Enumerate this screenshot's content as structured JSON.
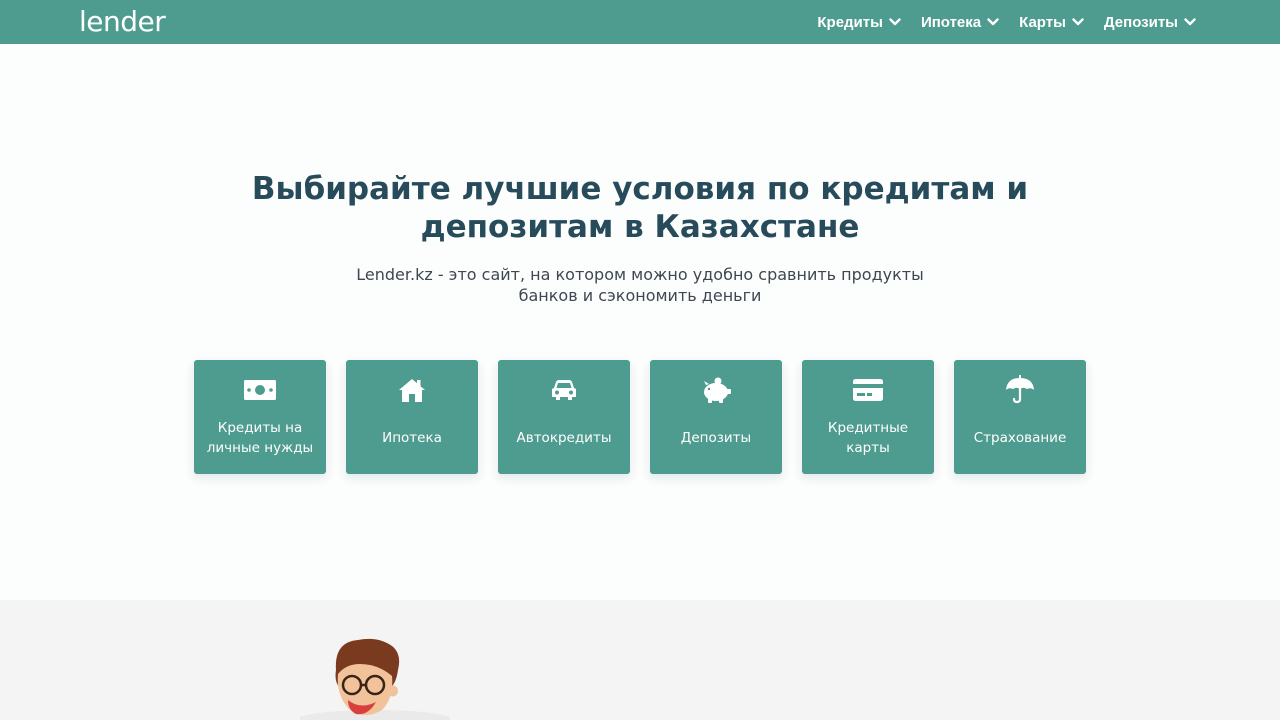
{
  "header": {
    "logo": "lender",
    "nav": [
      {
        "label": "Кредиты"
      },
      {
        "label": "Ипотека"
      },
      {
        "label": "Карты"
      },
      {
        "label": "Депозиты"
      }
    ]
  },
  "hero": {
    "title": "Выбирайте лучшие условия по кредитам и депозитам в Казахстане",
    "subtitle": "Lender.kz - это сайт, на котором можно удобно сравнить продукты банков и сэкономить деньги"
  },
  "categories": [
    {
      "label": "Кредиты на личные нужды",
      "icon": "money-bill-icon"
    },
    {
      "label": "Ипотека",
      "icon": "house-icon"
    },
    {
      "label": "Автокредиты",
      "icon": "car-icon"
    },
    {
      "label": "Депозиты",
      "icon": "piggy-bank-icon"
    },
    {
      "label": "Кредитные карты",
      "icon": "credit-card-icon"
    },
    {
      "label": "Страхование",
      "icon": "umbrella-icon"
    }
  ],
  "colors": {
    "brand": "#4e9c8f",
    "title": "#274b5b",
    "text": "#3f4750",
    "band": "#f4f4f4"
  }
}
